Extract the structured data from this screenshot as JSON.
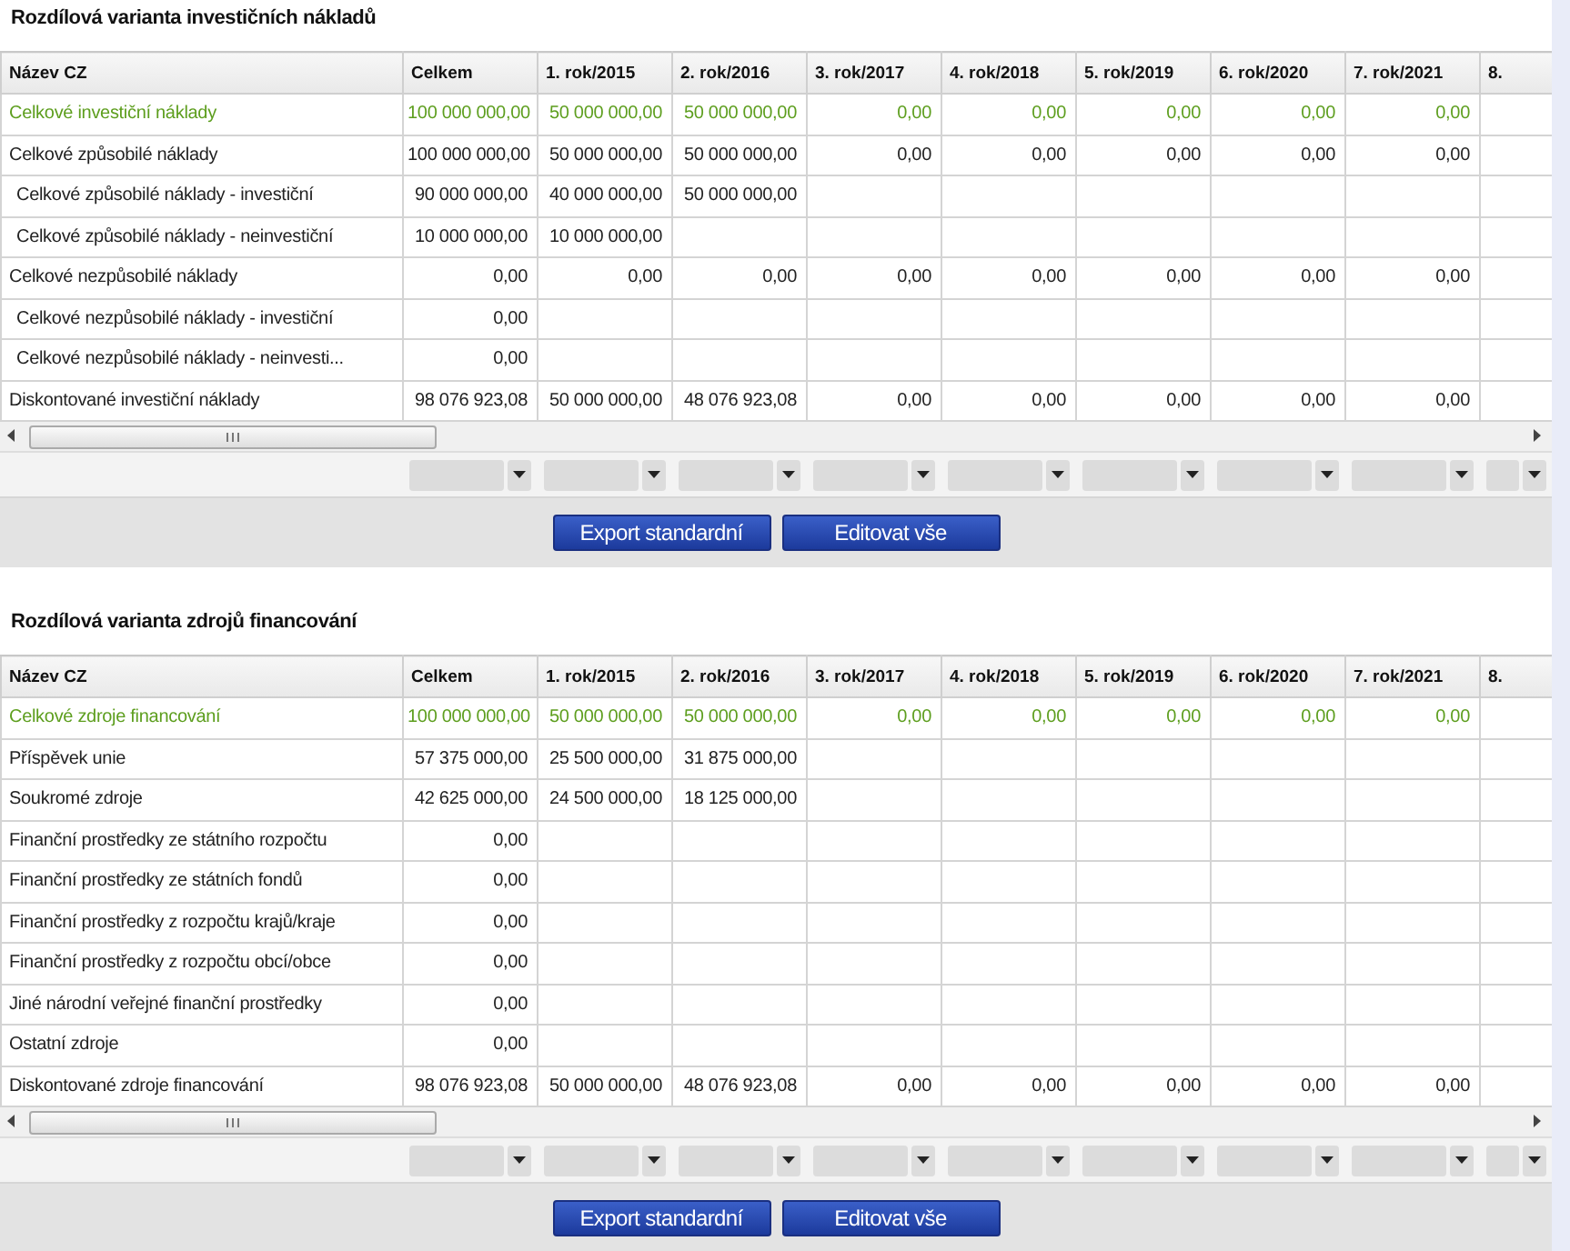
{
  "sections": [
    {
      "title": "Rozdílová varianta investičních nákladů",
      "columns": [
        "Název CZ",
        "Celkem",
        "1. rok/2015",
        "2. rok/2016",
        "3. rok/2017",
        "4. rok/2018",
        "5. rok/2019",
        "6. rok/2020",
        "7. rok/2021",
        "8."
      ],
      "rows": [
        {
          "kind": "total",
          "cells": [
            "Celkové investiční náklady",
            "100 000 000,00",
            "50 000 000,00",
            "50 000 000,00",
            "0,00",
            "0,00",
            "0,00",
            "0,00",
            "0,00",
            null
          ]
        },
        {
          "kind": "normal",
          "cells": [
            "Celkové způsobilé náklady",
            "100 000 000,00",
            "50 000 000,00",
            "50 000 000,00",
            "0,00",
            "0,00",
            "0,00",
            "0,00",
            "0,00",
            null
          ]
        },
        {
          "kind": "sub",
          "cells": [
            "Celkové způsobilé náklady - investiční",
            "90 000 000,00",
            "40 000 000,00",
            "50 000 000,00",
            null,
            null,
            null,
            null,
            null,
            null
          ]
        },
        {
          "kind": "sub",
          "cells": [
            "Celkové způsobilé náklady - neinvestiční",
            "10 000 000,00",
            "10 000 000,00",
            null,
            null,
            null,
            null,
            null,
            null,
            null
          ]
        },
        {
          "kind": "normal",
          "cells": [
            "Celkové nezpůsobilé náklady",
            "0,00",
            "0,00",
            "0,00",
            "0,00",
            "0,00",
            "0,00",
            "0,00",
            "0,00",
            null
          ]
        },
        {
          "kind": "sub",
          "cells": [
            "Celkové nezpůsobilé náklady - investiční",
            "0,00",
            null,
            null,
            null,
            null,
            null,
            null,
            null,
            null
          ]
        },
        {
          "kind": "sub",
          "cells": [
            "Celkové nezpůsobilé náklady - neinvesti...",
            "0,00",
            null,
            null,
            null,
            null,
            null,
            null,
            null,
            null
          ]
        },
        {
          "kind": "normal",
          "cells": [
            "Diskontované investiční náklady",
            "98 076 923,08",
            "50 000 000,00",
            "48 076 923,08",
            "0,00",
            "0,00",
            "0,00",
            "0,00",
            "0,00",
            null
          ]
        }
      ],
      "buttons": [
        "Export standardní",
        "Editovat vše"
      ]
    },
    {
      "title": "Rozdílová varianta zdrojů financování",
      "columns": [
        "Název CZ",
        "Celkem",
        "1. rok/2015",
        "2. rok/2016",
        "3. rok/2017",
        "4. rok/2018",
        "5. rok/2019",
        "6. rok/2020",
        "7. rok/2021",
        "8."
      ],
      "rows": [
        {
          "kind": "total",
          "cells": [
            "Celkové zdroje financování",
            "100 000 000,00",
            "50 000 000,00",
            "50 000 000,00",
            "0,00",
            "0,00",
            "0,00",
            "0,00",
            "0,00",
            null
          ]
        },
        {
          "kind": "normal",
          "cells": [
            "Příspěvek unie",
            "57 375 000,00",
            "25 500 000,00",
            "31 875 000,00",
            null,
            null,
            null,
            null,
            null,
            null
          ]
        },
        {
          "kind": "normal",
          "cells": [
            "Soukromé zdroje",
            "42 625 000,00",
            "24 500 000,00",
            "18 125 000,00",
            null,
            null,
            null,
            null,
            null,
            null
          ]
        },
        {
          "kind": "normal",
          "cells": [
            "Finanční prostředky ze státního rozpočtu",
            "0,00",
            null,
            null,
            null,
            null,
            null,
            null,
            null,
            null
          ]
        },
        {
          "kind": "normal",
          "cells": [
            "Finanční prostředky ze státních fondů",
            "0,00",
            null,
            null,
            null,
            null,
            null,
            null,
            null,
            null
          ]
        },
        {
          "kind": "normal",
          "cells": [
            "Finanční prostředky z rozpočtu krajů/kraje",
            "0,00",
            null,
            null,
            null,
            null,
            null,
            null,
            null,
            null
          ]
        },
        {
          "kind": "normal",
          "cells": [
            "Finanční prostředky z rozpočtu obcí/obce",
            "0,00",
            null,
            null,
            null,
            null,
            null,
            null,
            null,
            null
          ]
        },
        {
          "kind": "normal",
          "cells": [
            "Jiné národní veřejné finanční prostředky",
            "0,00",
            null,
            null,
            null,
            null,
            null,
            null,
            null,
            null
          ]
        },
        {
          "kind": "normal",
          "cells": [
            "Ostatní zdroje",
            "0,00",
            null,
            null,
            null,
            null,
            null,
            null,
            null,
            null
          ]
        },
        {
          "kind": "normal",
          "cells": [
            "Diskontované zdroje financování",
            "98 076 923,08",
            "50 000 000,00",
            "48 076 923,08",
            "0,00",
            "0,00",
            "0,00",
            "0,00",
            "0,00",
            null
          ]
        }
      ],
      "buttons": [
        "Export standardní",
        "Editovat vše"
      ]
    }
  ]
}
